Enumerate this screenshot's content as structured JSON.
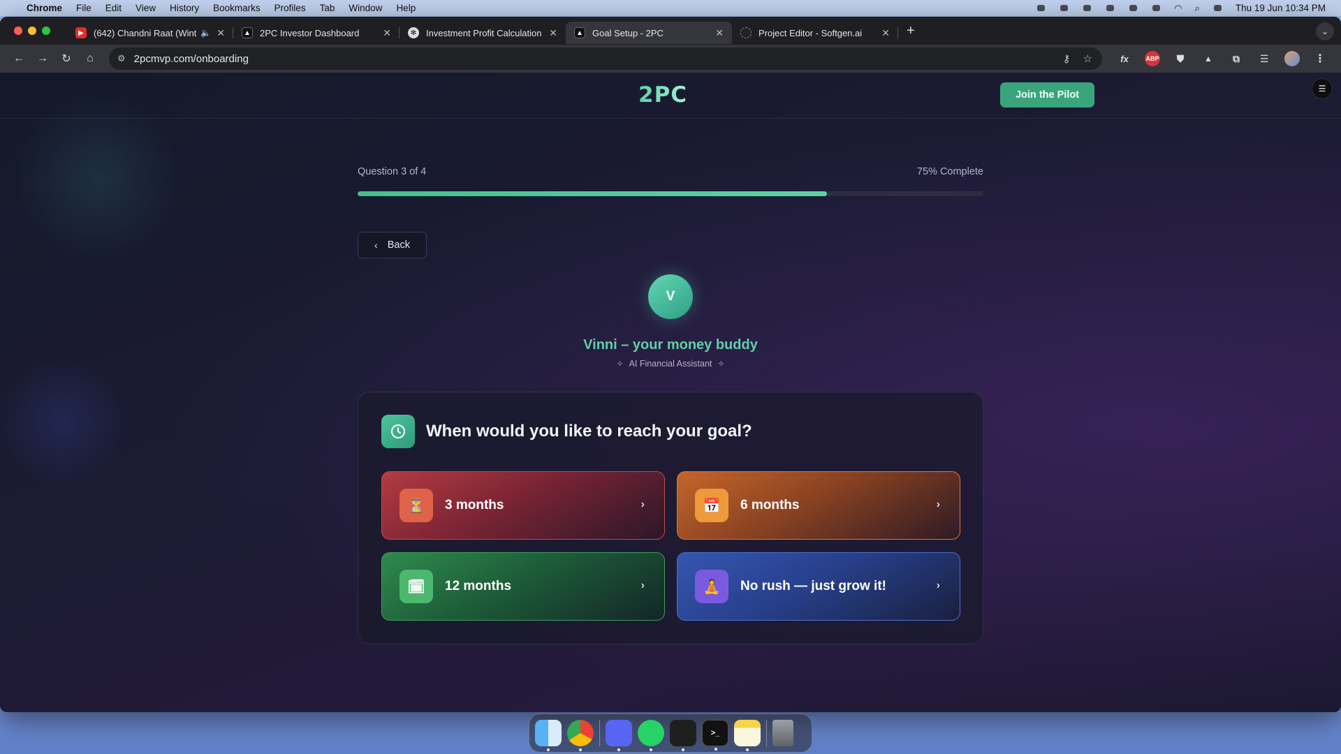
{
  "menubar": {
    "app": "Chrome",
    "items": [
      "File",
      "Edit",
      "View",
      "History",
      "Bookmarks",
      "Profiles",
      "Tab",
      "Window",
      "Help"
    ],
    "clock": "Thu 19 Jun  10:34 PM"
  },
  "tabs": [
    {
      "title": "(642) Chandni Raat (Wint",
      "favicon": "youtube-icon",
      "audio": true
    },
    {
      "title": "2PC Investor Dashboard",
      "favicon": "triangle-icon"
    },
    {
      "title": "Investment Profit Calculation",
      "favicon": "openai-icon"
    },
    {
      "title": "Goal Setup - 2PC",
      "favicon": "triangle-icon",
      "active": true
    },
    {
      "title": "Project Editor - Softgen.ai",
      "favicon": "softgen-icon"
    }
  ],
  "address": {
    "url": "2pcmvp.com/onboarding"
  },
  "extensions": [
    "fx",
    "ABP"
  ],
  "site": {
    "logo": "2PC",
    "cta": "Join the Pilot"
  },
  "progress": {
    "step_text": "Question 3 of 4",
    "percent_text": "75% Complete",
    "fraction": 0.75
  },
  "back_label": "Back",
  "assistant": {
    "initial": "V",
    "name": "Vinni – your money buddy",
    "role": "AI Financial Assistant"
  },
  "question": {
    "icon": "clock-icon",
    "text": "When would you like to reach your goal?"
  },
  "options": [
    {
      "label": "3 months",
      "emoji": "⏳",
      "color": "#b33b42"
    },
    {
      "label": "6 months",
      "emoji": "📅",
      "color": "#c5662a"
    },
    {
      "label": "12 months",
      "emoji": "🗓",
      "color": "#2f8a4d"
    },
    {
      "label": "No rush — just grow it!",
      "emoji": "🧘",
      "color": "#3456b0"
    }
  ],
  "colors": {
    "accent": "#3aa57d",
    "brand": "#5fd0a8",
    "page_bg": "#1b1b33"
  }
}
